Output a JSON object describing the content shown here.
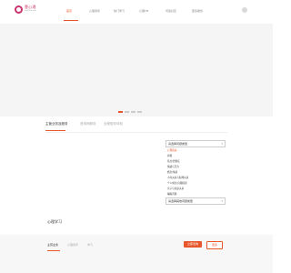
{
  "brand": {
    "name": "壹心理",
    "sub": "xinli001.com",
    "accent": "#e8572b",
    "logo_color": "#c9346f"
  },
  "nav": {
    "items": [
      "首页",
      "心理测评",
      "热门学习",
      "心理FM",
      "问答社区",
      "更多服务"
    ],
    "active_index": 0
  },
  "user_icon": "user-avatar-icon",
  "hero": {
    "carousel_active": 0,
    "carousel_count": 4
  },
  "tabs": {
    "items": [
      "主营业务及服务",
      "咨询师服务",
      "全程陪伴体验"
    ],
    "active_index": 0
  },
  "select_top": {
    "value": "请选择问题类型"
  },
  "options": [
    "心理疾病",
    "抑郁",
    "焦虑/恐惧症",
    "情绪与压力",
    "婚恋/情感",
    "人际关系与职场关系",
    "个人成长/自我探索",
    "亲子与家庭关系",
    "睡眠问题"
  ],
  "selected_option": 0,
  "select_bottom": {
    "value": "请选择其他问题类型"
  },
  "section_title": "心理学习",
  "footer": {
    "tabs": [
      "主营业务",
      "心理测评",
      "学习"
    ],
    "active_index": 0,
    "primary_button": "立即咨询",
    "secondary_button": "更多"
  }
}
